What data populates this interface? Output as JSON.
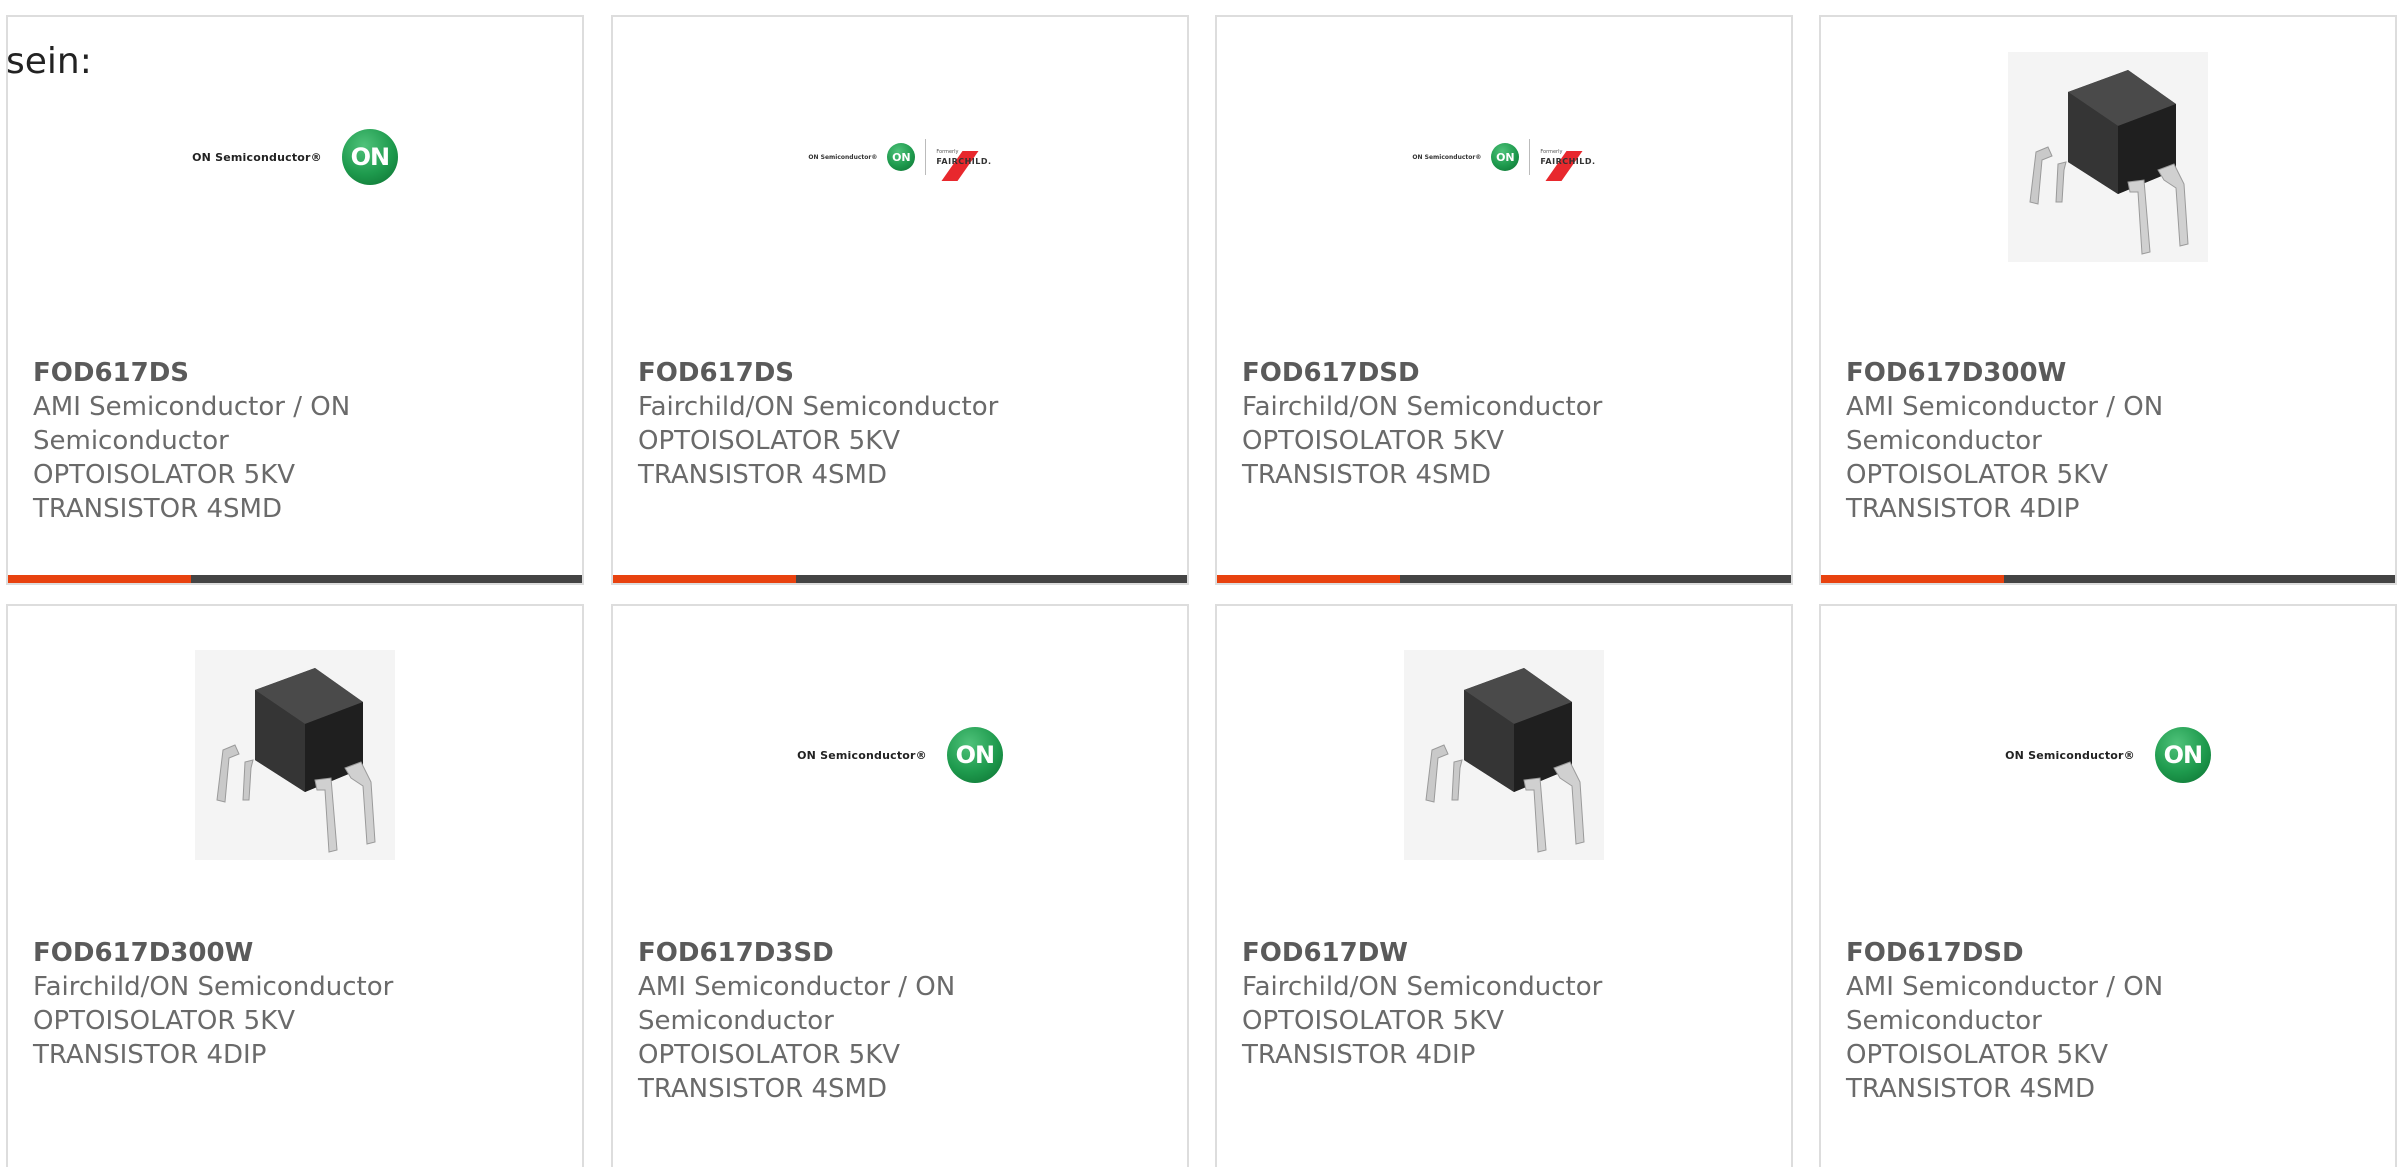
{
  "heading": "sein:",
  "colors": {
    "accent": "#e8420f",
    "bar": "#444444",
    "on_green": "#1e9a4d",
    "fairchild_red": "#e8282d"
  },
  "logos": {
    "on_text": "ON Semiconductor",
    "on_mark": "ON",
    "formerly": "Formerly",
    "fairchild": "FAIRCHILD."
  },
  "products": [
    {
      "part": "FOD617DS",
      "lines": [
        "AMI Semiconductor / ON",
        "Semiconductor",
        "OPTOISOLATOR 5KV",
        "TRANSISTOR 4SMD"
      ],
      "image": "on-semiconductor-logo"
    },
    {
      "part": "FOD617DS",
      "lines": [
        "Fairchild/ON Semiconductor",
        "OPTOISOLATOR 5KV",
        "TRANSISTOR 4SMD"
      ],
      "image": "on-fairchild-logo"
    },
    {
      "part": "FOD617DSD",
      "lines": [
        "Fairchild/ON Semiconductor",
        "OPTOISOLATOR 5KV",
        "TRANSISTOR 4SMD"
      ],
      "image": "on-fairchild-logo"
    },
    {
      "part": "FOD617D300W",
      "lines": [
        "AMI Semiconductor / ON",
        "Semiconductor",
        "OPTOISOLATOR 5KV",
        "TRANSISTOR 4DIP"
      ],
      "image": "dip-chip-photo"
    },
    {
      "part": "FOD617D300W",
      "lines": [
        "Fairchild/ON Semiconductor",
        "OPTOISOLATOR 5KV",
        "TRANSISTOR 4DIP"
      ],
      "image": "dip-chip-photo"
    },
    {
      "part": "FOD617D3SD",
      "lines": [
        "AMI Semiconductor / ON",
        "Semiconductor",
        "OPTOISOLATOR 5KV",
        "TRANSISTOR 4SMD"
      ],
      "image": "on-semiconductor-logo"
    },
    {
      "part": "FOD617DW",
      "lines": [
        "Fairchild/ON Semiconductor",
        "OPTOISOLATOR 5KV",
        "TRANSISTOR 4DIP"
      ],
      "image": "dip-chip-photo"
    },
    {
      "part": "FOD617DSD",
      "lines": [
        "AMI Semiconductor / ON",
        "Semiconductor",
        "OPTOISOLATOR 5KV",
        "TRANSISTOR 4SMD"
      ],
      "image": "on-semiconductor-logo"
    }
  ]
}
